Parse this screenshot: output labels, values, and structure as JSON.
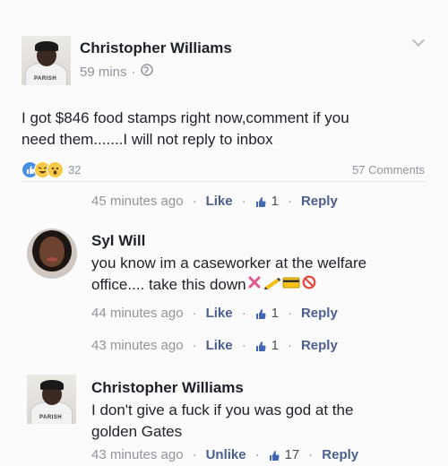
{
  "post": {
    "author": "Christopher Williams",
    "time": "59 mins",
    "separator": "·",
    "text_line1": "I got $846 food stamps right now,comment if you",
    "text_line2": "need them.......I will not reply to inbox",
    "reactions_count": "32",
    "comments_count": "57 Comments",
    "avatar_text": "PARISH",
    "icons": [
      "globe-icon",
      "chevron-down-icon",
      "like-reaction-icon",
      "haha-reaction-icon",
      "wow-reaction-icon"
    ]
  },
  "post_actions": {
    "time": "45 minutes ago",
    "like": "Like",
    "likes_count": "1",
    "reply": "Reply"
  },
  "comments": [
    {
      "author": "Syl Will",
      "line1": "you know im a caseworker at the welfare",
      "line2": "office.... take this down",
      "time": "44 minutes ago",
      "like": "Like",
      "likes_count": "1",
      "reply": "Reply",
      "icons": [
        "cross-mark-icon",
        "pencil-icon",
        "credit-card-icon",
        "prohibited-icon"
      ]
    },
    {
      "time": "43 minutes ago",
      "like": "Like",
      "likes_count": "1",
      "reply": "Reply"
    },
    {
      "author": "Christopher Williams",
      "line1": "I don't give a fuck if you was god at the",
      "line2": "golden Gates",
      "time": "43 minutes ago",
      "like": "Unlike",
      "likes_count": "17",
      "reply": "Reply",
      "avatar_text": "PARISH"
    }
  ],
  "colors": {
    "link": "#4267b2",
    "meta": "#90949c",
    "text": "#1d2129"
  }
}
